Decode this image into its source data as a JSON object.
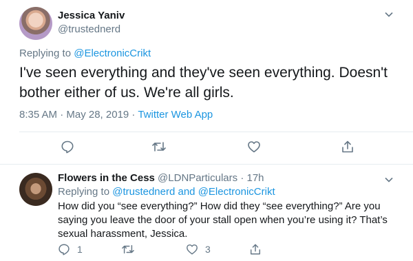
{
  "main_tweet": {
    "author_name": "Jessica Yaniv",
    "author_handle": "@trustednerd",
    "replying_to_prefix": "Replying to",
    "replying_to_handle": "@ElectronicCrikt",
    "text": "I've seen everything and they've seen everything. Doesn't bother either of us. We're all girls.",
    "timestamp": "8:35 AM · May 28, 2019 · ",
    "source": "Twitter Web App"
  },
  "reply_tweet": {
    "author_name": "Flowers in the Cess",
    "author_handle": "@LDNParticulars",
    "time": "· 17h",
    "replying_to_prefix": "Replying to",
    "replying_to_handle1": "@trustednerd",
    "and": "and",
    "replying_to_handle2": "@ElectronicCrikt",
    "text": "How did you “see everything?” How did they “see everything?” Are you saying you leave the door of your stall open when you’re using it? That’s sexual harassment, Jessica.",
    "reply_count": "1",
    "like_count": "3"
  },
  "icons": [
    "chevron-down-icon",
    "reply-icon",
    "retweet-icon",
    "like-icon",
    "share-icon"
  ],
  "colors": {
    "link": "#1b95e0",
    "muted": "#657786",
    "text": "#14171a",
    "divider": "#e6ecf0"
  }
}
